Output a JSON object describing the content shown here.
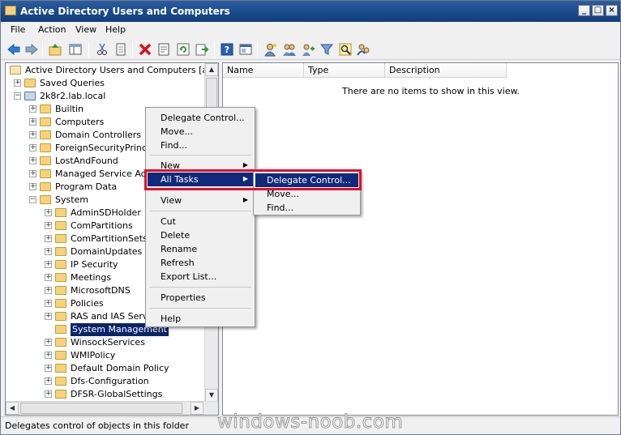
{
  "window": {
    "title": "Active Directory Users and Computers",
    "minimize": "_",
    "maximize": "□",
    "close": "×"
  },
  "menubar": [
    "File",
    "Action",
    "View",
    "Help"
  ],
  "toolbar": {
    "icons": [
      "back-icon",
      "forward-icon",
      "up-icon",
      "show-tree-icon",
      "cut-icon",
      "copy-icon",
      "delete-icon",
      "properties-icon",
      "refresh-icon",
      "export-icon",
      "help-icon",
      "console-icon",
      "new-user-icon",
      "new-group-icon",
      "filter-icon",
      "add-to-group-icon",
      "find-icon"
    ]
  },
  "tree": {
    "root": "Active Directory Users and Computers [ad1.2k",
    "items": [
      {
        "label": "Saved Queries",
        "level": 1,
        "expander": "+"
      },
      {
        "label": "2k8r2.lab.local",
        "level": 1,
        "expander": "−"
      },
      {
        "label": "Builtin",
        "level": 2,
        "expander": "+"
      },
      {
        "label": "Computers",
        "level": 2,
        "expander": "+"
      },
      {
        "label": "Domain Controllers",
        "level": 2,
        "expander": "+"
      },
      {
        "label": "ForeignSecurityPrincipa",
        "level": 2,
        "expander": "+"
      },
      {
        "label": "LostAndFound",
        "level": 2,
        "expander": "+"
      },
      {
        "label": "Managed Service Accou",
        "level": 2,
        "expander": "+"
      },
      {
        "label": "Program Data",
        "level": 2,
        "expander": "+"
      },
      {
        "label": "System",
        "level": 2,
        "expander": "−"
      },
      {
        "label": "AdminSDHolder",
        "level": 3,
        "expander": "+"
      },
      {
        "label": "ComPartitions",
        "level": 3,
        "expander": "+"
      },
      {
        "label": "ComPartitionSets",
        "level": 3,
        "expander": "+"
      },
      {
        "label": "DomainUpdates",
        "level": 3,
        "expander": "+"
      },
      {
        "label": "IP Security",
        "level": 3,
        "expander": "+"
      },
      {
        "label": "Meetings",
        "level": 3,
        "expander": "+"
      },
      {
        "label": "MicrosoftDNS",
        "level": 3,
        "expander": "+"
      },
      {
        "label": "Policies",
        "level": 3,
        "expander": "+"
      },
      {
        "label": "RAS and IAS Serve",
        "level": 3,
        "expander": "+"
      },
      {
        "label": "System Management",
        "level": 3,
        "expander": ""
      },
      {
        "label": "WinsockServices",
        "level": 3,
        "expander": "+"
      },
      {
        "label": "WMIPolicy",
        "level": 3,
        "expander": "+"
      },
      {
        "label": "Default Domain Policy",
        "level": 3,
        "expander": "+"
      },
      {
        "label": "Dfs-Configuration",
        "level": 3,
        "expander": "+"
      },
      {
        "label": "DFSR-GlobalSettings",
        "level": 3,
        "expander": "+"
      }
    ]
  },
  "list": {
    "columns": [
      "Name",
      "Type",
      "Description"
    ],
    "empty_message": "There are no items to show in this view."
  },
  "context_menu": {
    "items": [
      "Delegate Control...",
      "Move...",
      "Find...",
      "New",
      "All Tasks",
      "View",
      "Cut",
      "Delete",
      "Rename",
      "Refresh",
      "Export List...",
      "Properties",
      "Help"
    ]
  },
  "submenu": {
    "items": [
      "Delegate Control...",
      "Move...",
      "Find..."
    ]
  },
  "status": "Delegates control of objects in this folder",
  "watermark": "windows-noob.com",
  "colors": {
    "titlebar": "#194a8c",
    "highlight": "#10297a",
    "callout": "#e0102a"
  }
}
